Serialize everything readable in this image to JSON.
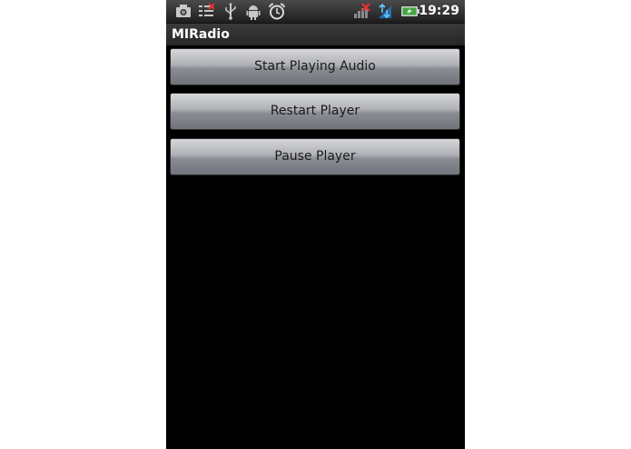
{
  "status_bar": {
    "time": "19:29",
    "icons": [
      "camera-icon",
      "checklist-icon",
      "usb-icon",
      "android-debug-icon",
      "alarm-clock-icon",
      "no-signal-icon",
      "data-transfer-icon",
      "battery-charging-icon"
    ]
  },
  "app": {
    "title": "MIRadio"
  },
  "buttons": {
    "start": "Start Playing Audio",
    "restart": "Restart Player",
    "pause": "Pause Player"
  }
}
